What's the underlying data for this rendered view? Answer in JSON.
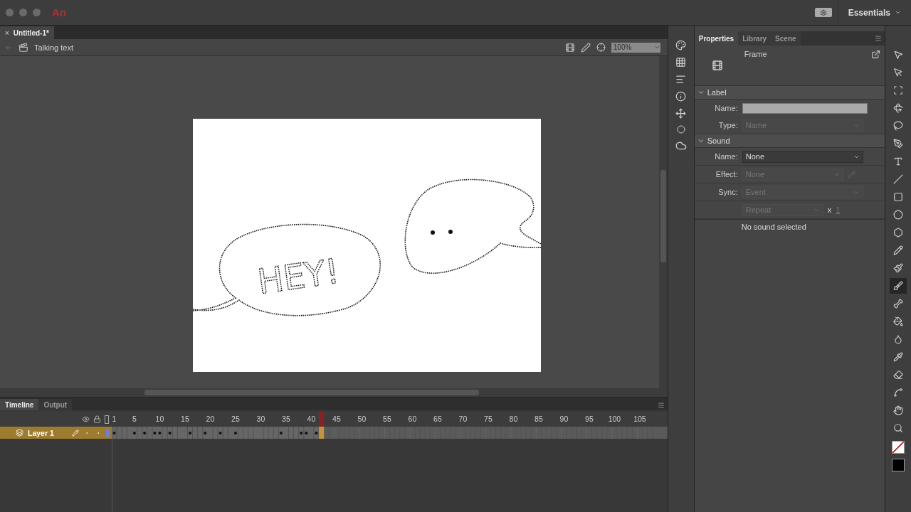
{
  "app": {
    "logo": "An",
    "workspace": "Essentials"
  },
  "document_tab": {
    "close": "×",
    "title": "Untitled-1*"
  },
  "edit_bar": {
    "scene": "Talking text",
    "zoom": "100%"
  },
  "stage": {
    "text": "HEY!"
  },
  "panel_tabs": [
    {
      "label": "Properties",
      "selected": true
    },
    {
      "label": "Library",
      "selected": false
    },
    {
      "label": "Scene",
      "selected": false
    }
  ],
  "properties": {
    "title": "Frame",
    "sections": [
      {
        "title": "Label",
        "expanded": true,
        "rows": [
          {
            "kind": "input",
            "label": "Name:",
            "disabled": false
          },
          {
            "kind": "select",
            "label": "Type:",
            "value": "Name",
            "disabled": true
          }
        ]
      },
      {
        "title": "Sound",
        "expanded": true,
        "rows": [
          {
            "kind": "select",
            "label": "Name:",
            "value": "None",
            "disabled": false
          },
          {
            "kind": "select-edit",
            "label": "Effect:",
            "value": "None",
            "disabled": true
          },
          {
            "kind": "select",
            "label": "Sync:",
            "value": "Event",
            "disabled": true
          },
          {
            "kind": "repeat",
            "value": "Repeat",
            "times_sign": "x",
            "count": "1",
            "disabled": true
          }
        ]
      }
    ],
    "status": "No sound selected"
  },
  "timeline": {
    "tabs": [
      {
        "label": "Timeline",
        "selected": true
      },
      {
        "label": "Output",
        "selected": false
      }
    ],
    "frame_numbers": [
      "1",
      "5",
      "10",
      "15",
      "20",
      "25",
      "30",
      "35",
      "40",
      "45",
      "50",
      "55",
      "60",
      "65",
      "70",
      "75",
      "80",
      "85",
      "90",
      "95",
      "100",
      "105"
    ],
    "layers": [
      {
        "name": "Layer 1",
        "selected": true
      }
    ]
  },
  "tools": [
    {
      "kind": "select",
      "selected": false
    },
    {
      "kind": "subselect",
      "selected": false
    },
    {
      "kind": "transform",
      "selected": false
    },
    {
      "kind": "rotate3d",
      "selected": false
    },
    {
      "kind": "lasso",
      "selected": false
    },
    {
      "kind": "pen",
      "selected": false
    },
    {
      "kind": "text",
      "selected": false
    },
    {
      "kind": "line",
      "selected": false
    },
    {
      "kind": "rect",
      "selected": false
    },
    {
      "kind": "oval",
      "selected": false
    },
    {
      "kind": "poly",
      "selected": false
    },
    {
      "kind": "pencil",
      "selected": false
    },
    {
      "kind": "paintbrush",
      "selected": false
    },
    {
      "kind": "brush",
      "selected": true
    },
    {
      "kind": "bone",
      "selected": false
    },
    {
      "kind": "bucket",
      "selected": false
    },
    {
      "kind": "inkbottle",
      "selected": false
    },
    {
      "kind": "eyedropper",
      "selected": false
    },
    {
      "kind": "eraser",
      "selected": false
    },
    {
      "kind": "width",
      "selected": false
    },
    {
      "kind": "hand",
      "selected": false
    },
    {
      "kind": "zoom",
      "selected": false
    }
  ]
}
